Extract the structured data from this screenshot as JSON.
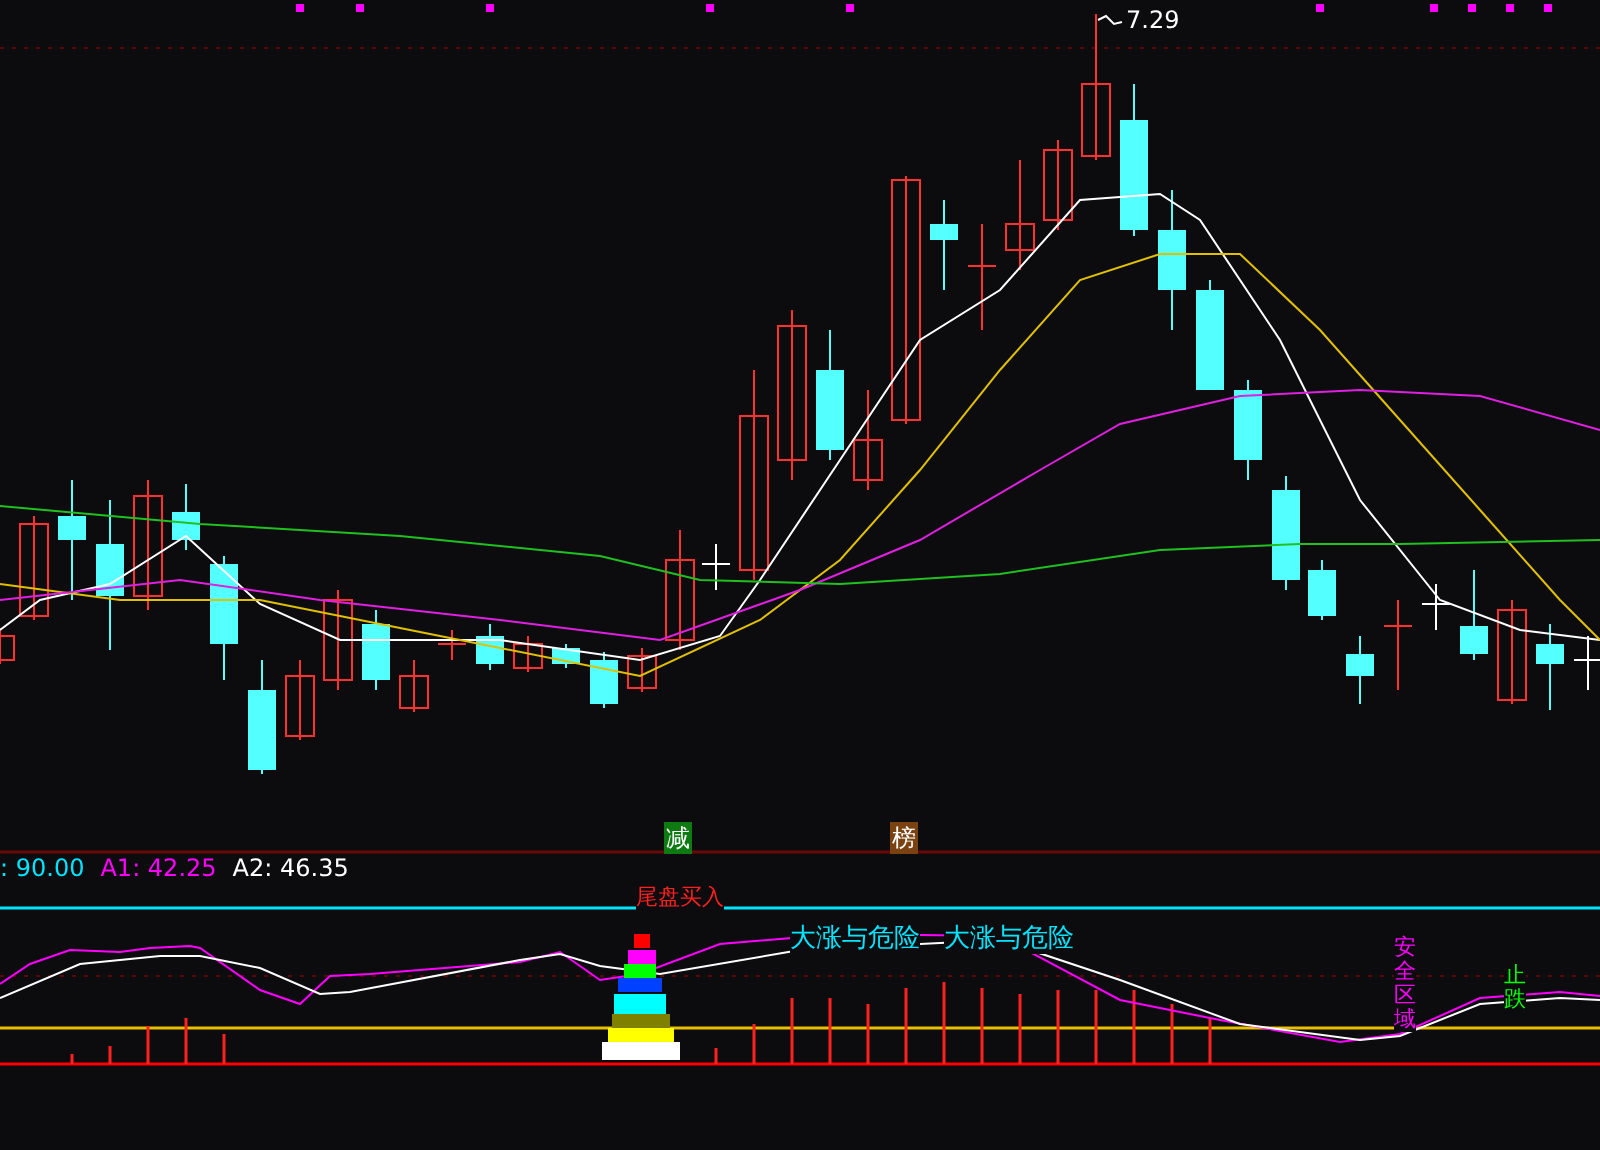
{
  "main_chart": {
    "high_price": "7.29",
    "signals": [
      {
        "text": "减",
        "color": "#0e7a12"
      },
      {
        "text": "榜",
        "color": "#7a4210"
      }
    ]
  },
  "indicator": {
    "readings": [
      {
        "text": ": 90.00",
        "color": "#00e5ff"
      },
      {
        "text": "A1: 42.25",
        "color": "#ff00ff"
      },
      {
        "text": "A2: 46.35",
        "color": "#ffffff"
      }
    ],
    "labels": [
      {
        "text": "尾盘买入",
        "kind": "horizontal",
        "color": "#ff2020"
      },
      {
        "text": "大涨与危险",
        "kind": "horizontal",
        "color": "#00e5ff"
      },
      {
        "text": "大涨与危险",
        "kind": "horizontal",
        "color": "#00e5ff"
      },
      {
        "text": "安全区域",
        "kind": "vertical",
        "color": "#ff00ff"
      },
      {
        "text": "止跌",
        "kind": "vertical",
        "color": "#00ff00"
      }
    ]
  }
}
